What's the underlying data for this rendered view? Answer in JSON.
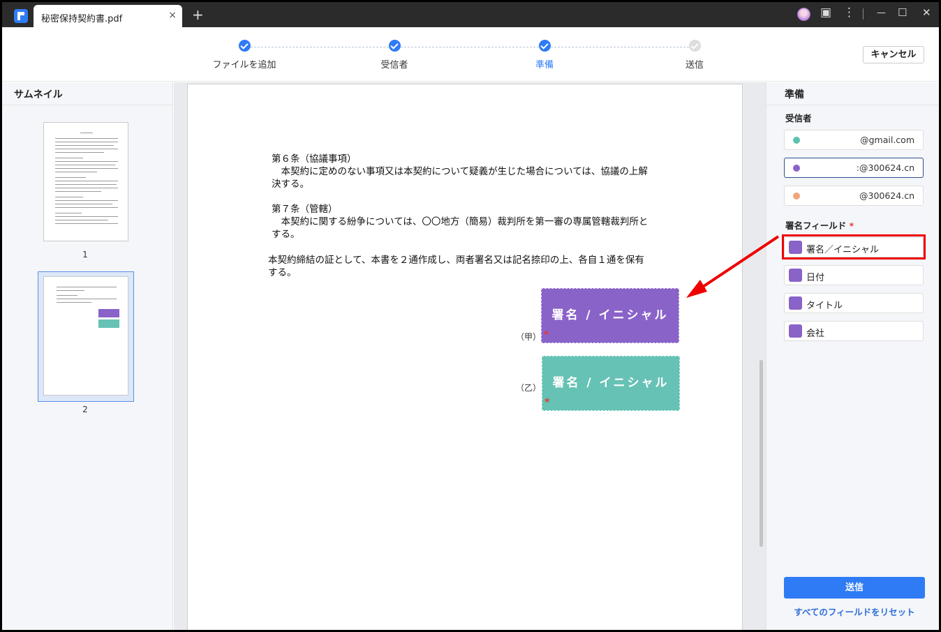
{
  "titlebar": {
    "tab_title": "秘密保持契約書.pdf",
    "tab_close": "×",
    "new_tab": "+",
    "icons": [
      "avatar",
      "chat-icon",
      "more-icon",
      "minimize-icon",
      "maximize-icon",
      "close-icon"
    ],
    "glyph_chat": "▣",
    "glyph_more": "⋮",
    "glyph_min": "—",
    "glyph_max": "☐",
    "glyph_close": "✕"
  },
  "stepper": {
    "steps": [
      {
        "label": "ファイルを追加",
        "state": "done"
      },
      {
        "label": "受信者",
        "state": "done"
      },
      {
        "label": "準備",
        "state": "active"
      },
      {
        "label": "送信",
        "state": "todo"
      }
    ],
    "cancel_label": "キャンセル"
  },
  "left_panel": {
    "title": "サムネイル",
    "pages": [
      "1",
      "2"
    ],
    "selected_page": "2"
  },
  "document": {
    "lines": [
      "第６条（協議事項）",
      "　本契約に定めのない事項又は本契約について疑義が生じた場合については、協議の上解",
      "決する。",
      "第７条（管轄）",
      "　本契約に関する紛争については、〇〇地方（簡易）裁判所を第一審の専属管轄裁判所と",
      "する。",
      "本契約締結の証として、本書を２通作成し、両者署名又は記名捺印の上、各自１通を保有",
      "する。"
    ],
    "party_a": "（甲）",
    "party_b": "（乙）",
    "sig_a_label": "署名 / イニシャル",
    "sig_b_label": "署名 / イニシャル",
    "required_mark": "*",
    "sig_a_color": "#8a63c9",
    "sig_b_color": "#66c2b4"
  },
  "right_panel": {
    "title": "準備",
    "recipients_label": "受信者",
    "recipients": [
      {
        "email": "@gmail.com",
        "color": "#5fc1b1"
      },
      {
        "email": ":@300624.cn",
        "color": "#8a63c9"
      },
      {
        "email": "@300624.cn",
        "color": "#f2a57a"
      }
    ],
    "fields_label": "署名フィールド",
    "required_mark": "*",
    "fields": [
      {
        "label": "署名／イニシャル"
      },
      {
        "label": "日付"
      },
      {
        "label": "タイトル"
      },
      {
        "label": "会社"
      }
    ],
    "send_label": "送信",
    "reset_label": "すべてのフィールドをリセット"
  },
  "colors": {
    "accent": "#2f7bf5",
    "highlight": "#ee0000"
  }
}
